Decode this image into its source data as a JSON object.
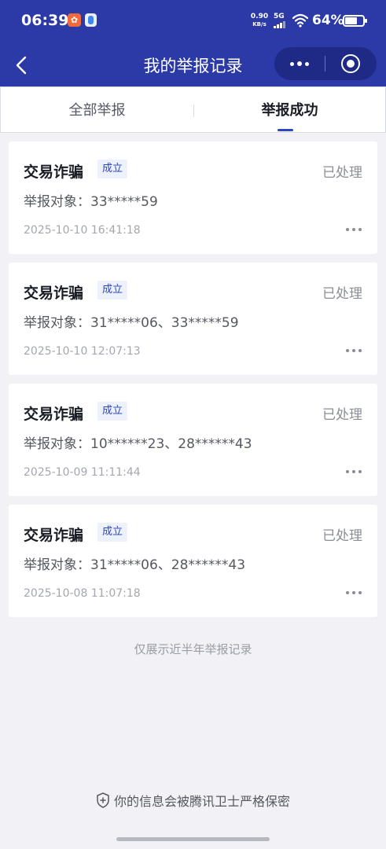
{
  "status_bar": {
    "time": "06:39",
    "net_speed_value": "0.90",
    "net_speed_unit": "KB/s",
    "network_type": "5G",
    "battery": "64%"
  },
  "nav": {
    "title": "我的举报记录"
  },
  "tabs": [
    {
      "label": "全部举报",
      "selected": false
    },
    {
      "label": "举报成功",
      "selected": true
    }
  ],
  "records": [
    {
      "title": "交易诈骗",
      "badge": "成立",
      "status": "已处理",
      "target": "举报对象：33*****59",
      "time": "2025-10-10 16:41:18"
    },
    {
      "title": "交易诈骗",
      "badge": "成立",
      "status": "已处理",
      "target": "举报对象：31*****06、33*****59",
      "time": "2025-10-10 12:07:13"
    },
    {
      "title": "交易诈骗",
      "badge": "成立",
      "status": "已处理",
      "target": "举报对象：10******23、28******43",
      "time": "2025-10-09 11:11:44"
    },
    {
      "title": "交易诈骗",
      "badge": "成立",
      "status": "已处理",
      "target": "举报对象：31*****06、28******43",
      "time": "2025-10-08 11:07:18"
    }
  ],
  "footer_note": "仅展示近半年举报记录",
  "privacy_text": "你的信息会被腾讯卫士严格保密",
  "colors": {
    "header": "#2b3aa6",
    "accent": "#2b47c2",
    "background": "#f1f1f6"
  }
}
